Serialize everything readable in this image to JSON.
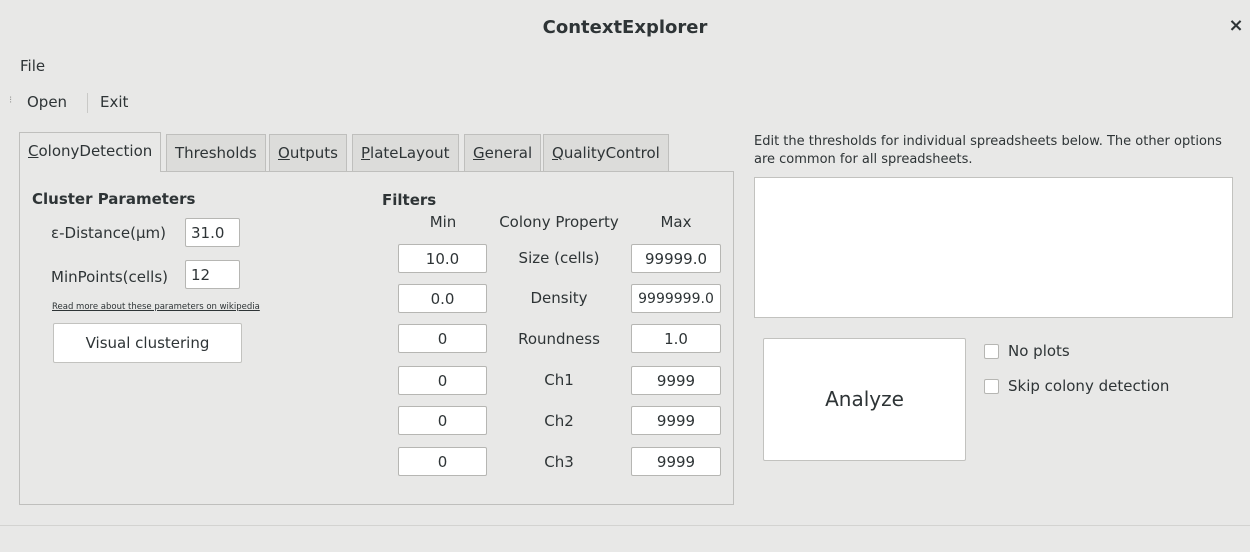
{
  "window": {
    "title": "ContextExplorer",
    "close_symbol": "×"
  },
  "menubar": {
    "file": "File"
  },
  "toolbar": {
    "open": "Open",
    "exit": "Exit"
  },
  "tabs": [
    {
      "label": "ColonyDetection",
      "mnemonic": "C",
      "rest": "olonyDetection",
      "active": true
    },
    {
      "label": "Thresholds",
      "active": false
    },
    {
      "label": "Outputs",
      "mnemonic": "O",
      "rest": "utputs",
      "active": false
    },
    {
      "label": "PlateLayout",
      "mnemonic": "P",
      "rest": "lateLayout",
      "active": false
    },
    {
      "label": "General",
      "mnemonic": "G",
      "rest": "eneral",
      "active": false
    },
    {
      "label": "QualityControl",
      "mnemonic": "Q",
      "rest": "ualityControl",
      "active": false
    }
  ],
  "cluster": {
    "heading": "Cluster Parameters",
    "epsilon_label": "ε-Distance(μm)",
    "epsilon_value": "31.0",
    "minpoints_label": "MinPoints(cells)",
    "minpoints_value": "12",
    "wiki_link": "Read more about these parameters on wikipedia",
    "visual_button": "Visual clustering"
  },
  "filters": {
    "heading": "Filters",
    "col_min": "Min",
    "col_property": "Colony Property",
    "col_max": "Max",
    "rows": [
      {
        "property": "Size (cells)",
        "min": "10.0",
        "max": "99999.0"
      },
      {
        "property": "Density",
        "min": "0.0",
        "max": "9999999.0"
      },
      {
        "property": "Roundness",
        "min": "0",
        "max": "1.0"
      },
      {
        "property": "Ch1",
        "min": "0",
        "max": "9999"
      },
      {
        "property": "Ch2",
        "min": "0",
        "max": "9999"
      },
      {
        "property": "Ch3",
        "min": "0",
        "max": "9999"
      }
    ]
  },
  "right_panel": {
    "description": "Edit the thresholds for individual spreadsheets below. The other options are common for all spreadsheets.",
    "analyze_button": "Analyze",
    "no_plots": "No plots",
    "skip_colony": "Skip colony detection"
  }
}
